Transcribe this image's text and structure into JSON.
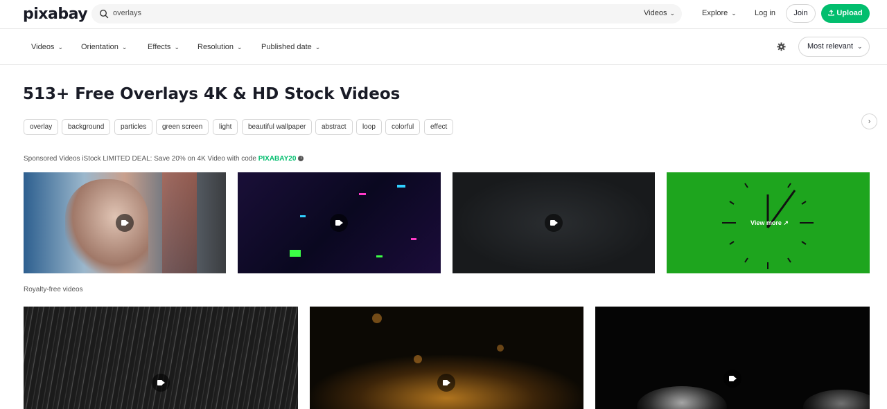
{
  "header": {
    "logo": "pixabay",
    "search_value": "overlays",
    "search_type": "Videos",
    "explore": "Explore",
    "login": "Log in",
    "join": "Join",
    "upload": "Upload"
  },
  "filters": {
    "items": [
      "Videos",
      "Orientation",
      "Effects",
      "Resolution",
      "Published date"
    ],
    "sort": "Most relevant"
  },
  "page": {
    "title": "513+ Free Overlays 4K & HD Stock Videos"
  },
  "tags": [
    "overlay",
    "background",
    "particles",
    "green screen",
    "light",
    "beautiful wallpaper",
    "abstract",
    "loop",
    "colorful",
    "effect"
  ],
  "sponsored": {
    "text": "Sponsored Videos iStock LIMITED DEAL: Save 20% on 4K Video with code ",
    "code": "PIXABAY20",
    "view_more": "View more"
  },
  "royalty_label": "Royalty-free videos",
  "colors": {
    "accent": "#02be6e",
    "green_screen": "#1ea51e"
  },
  "icons": {
    "search": "search-icon",
    "chevron": "chevron-down-icon",
    "upload": "upload-icon",
    "settings": "gear-icon",
    "next": "chevron-right-icon",
    "video": "video-camera-icon",
    "info": "info-icon"
  }
}
